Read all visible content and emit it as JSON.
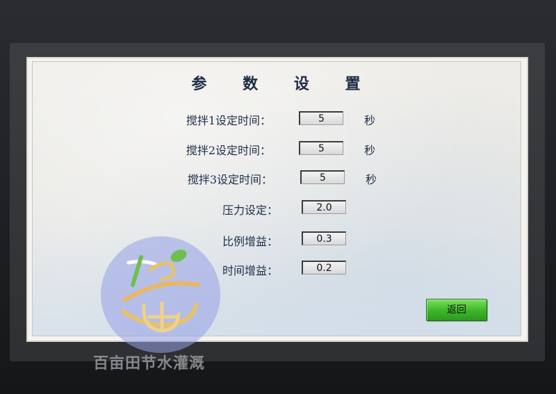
{
  "screen": {
    "title": "参 数 设 置",
    "params": [
      {
        "label": "搅拌1设定时间：",
        "value": "5",
        "unit": "秒"
      },
      {
        "label": "搅拌2设定时间：",
        "value": "5",
        "unit": "秒"
      },
      {
        "label": "搅拌3设定时间：",
        "value": "5",
        "unit": "秒"
      },
      {
        "label": "压力设定：",
        "value": "2.0",
        "unit": ""
      },
      {
        "label": "比例增益：",
        "value": "0.3",
        "unit": ""
      },
      {
        "label": "时间增益：",
        "value": "0.2",
        "unit": ""
      }
    ],
    "back_button": "返回"
  },
  "watermark": {
    "text": "百亩田节水灌溉"
  },
  "colors": {
    "back_button": "#3cb52a",
    "label_text": "#1f2d4a",
    "watermark_circle": "#969fe6"
  }
}
